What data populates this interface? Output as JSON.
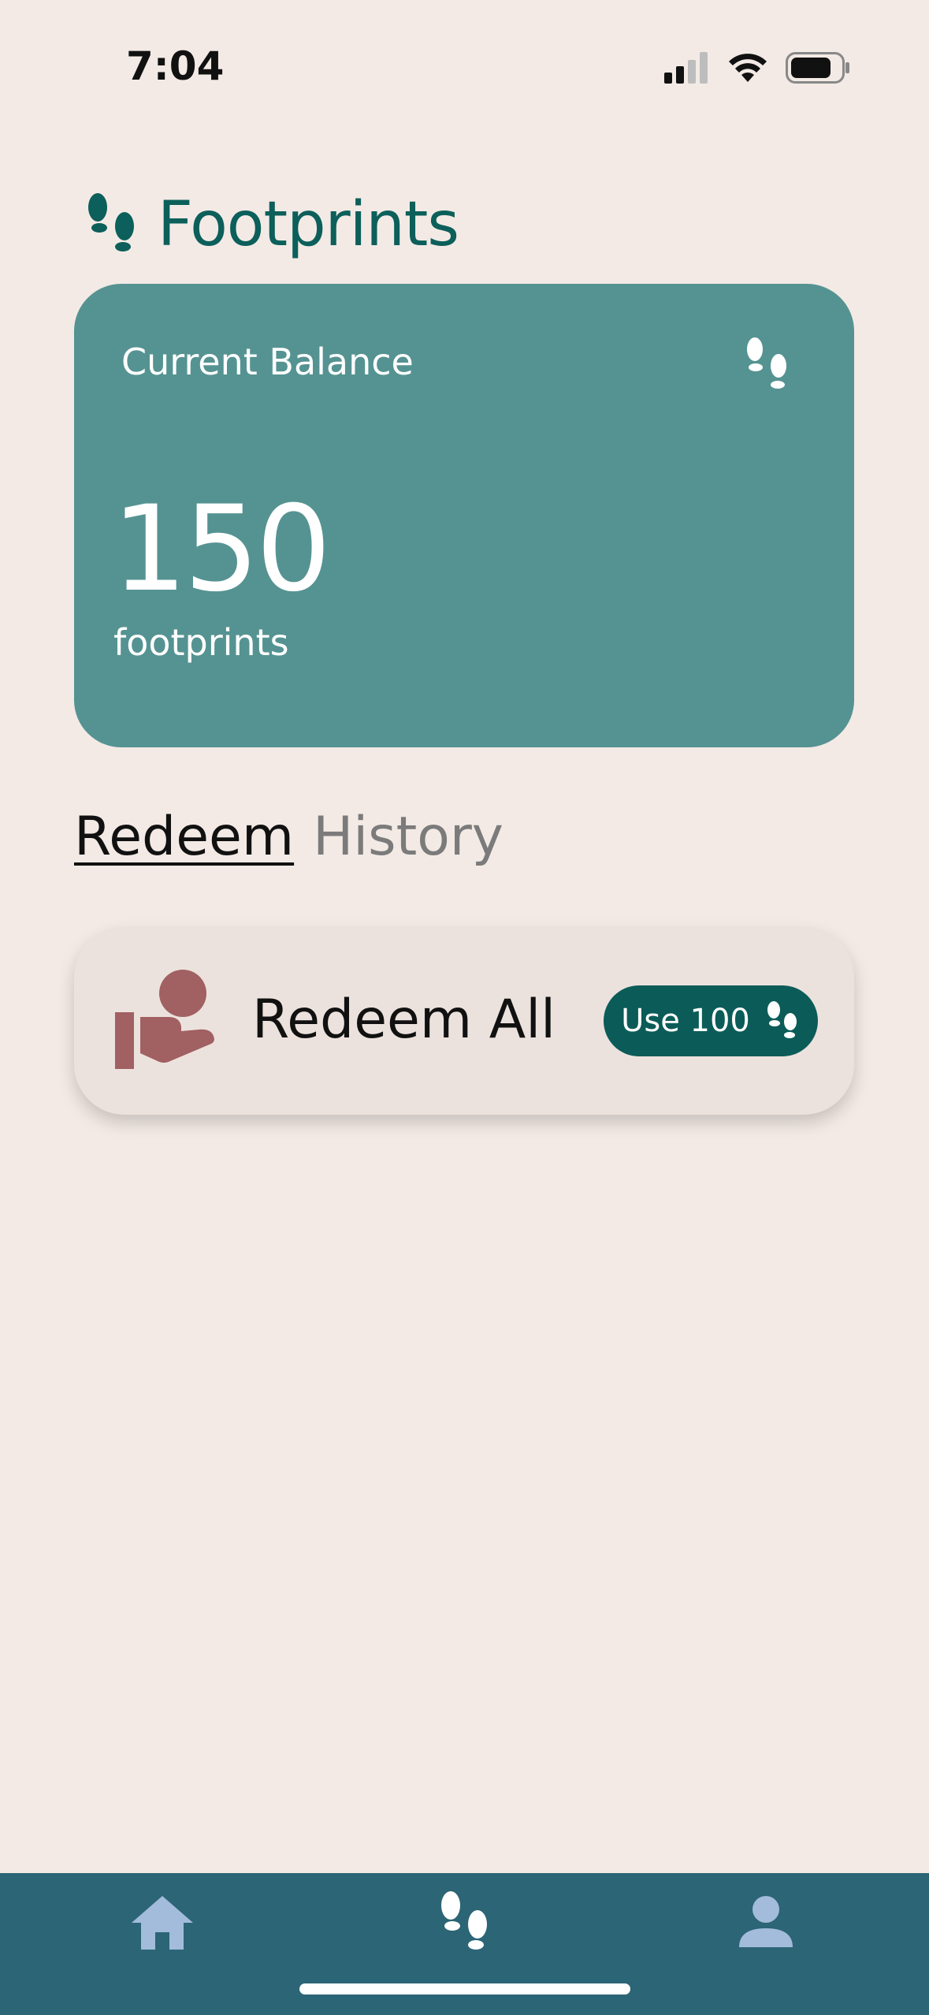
{
  "status_bar": {
    "time": "7:04"
  },
  "header": {
    "title": "Footprints",
    "icon": "footprints-icon"
  },
  "balance_card": {
    "label": "Current Balance",
    "value": "150",
    "unit": "footprints",
    "icon": "footprints-icon"
  },
  "tabs": [
    {
      "label": "Redeem",
      "active": true
    },
    {
      "label": "History",
      "active": false
    }
  ],
  "redeem_item": {
    "title": "Redeem All",
    "icon": "hand-give-icon",
    "button_label": "Use 100",
    "button_icon": "footprints-icon"
  },
  "bottom_nav": {
    "items": [
      {
        "icon": "home-icon"
      },
      {
        "icon": "footprints-icon"
      },
      {
        "icon": "profile-icon"
      }
    ]
  },
  "colors": {
    "background": "#F3EAE5",
    "brand_dark": "#0C5F5A",
    "card_teal": "#559392",
    "redeem_card": "#ECE2DD",
    "accent_rose": "#A16061",
    "nav_bar": "#2C6575",
    "nav_icon": "#A3BCDB"
  }
}
